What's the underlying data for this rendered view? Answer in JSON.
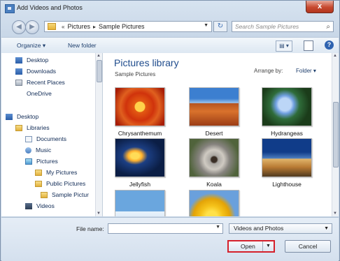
{
  "window": {
    "title": "Add Videos and Photos",
    "close_glyph": "x"
  },
  "nav": {
    "back": "◀",
    "forward": "▶"
  },
  "address": {
    "prefix": "«",
    "crumbs": [
      "Pictures",
      "Sample Pictures"
    ],
    "separator": "▸",
    "dropdown": "▼"
  },
  "refresh_icon": "refresh-icon",
  "search": {
    "placeholder": "Search Sample Pictures",
    "icon": "⌕"
  },
  "toolbar": {
    "organize": "Organize ▾",
    "new_folder": "New folder",
    "view": "▤ ▾",
    "help": "?"
  },
  "navpane": {
    "items": [
      {
        "label": "Desktop",
        "icon": "desktop-icon"
      },
      {
        "label": "Downloads",
        "icon": "downloads-icon"
      },
      {
        "label": "Recent Places",
        "icon": "recent-places-icon"
      },
      {
        "label": "OneDrive",
        "icon": "onedrive-icon"
      },
      {
        "label": "Desktop",
        "icon": "desktop-icon"
      },
      {
        "label": "Libraries",
        "icon": "libraries-icon"
      },
      {
        "label": "Documents",
        "icon": "documents-icon"
      },
      {
        "label": "Music",
        "icon": "music-icon"
      },
      {
        "label": "Pictures",
        "icon": "pictures-icon"
      },
      {
        "label": "My Pictures",
        "icon": "folder-icon"
      },
      {
        "label": "Public Pictures",
        "icon": "folder-icon"
      },
      {
        "label": "Sample Pictur",
        "icon": "folder-icon"
      },
      {
        "label": "Videos",
        "icon": "videos-icon"
      }
    ]
  },
  "content": {
    "title": "Pictures library",
    "subtitle": "Sample Pictures",
    "arrange_label": "Arrange by:",
    "arrange_value": "Folder ▾",
    "tiles": [
      {
        "label": "Chrysanthemum"
      },
      {
        "label": "Desert"
      },
      {
        "label": "Hydrangeas"
      },
      {
        "label": "Jellyfish"
      },
      {
        "label": "Koala"
      },
      {
        "label": "Lighthouse"
      },
      {
        "label": ""
      },
      {
        "label": ""
      }
    ]
  },
  "footer": {
    "file_name_label": "File name:",
    "file_name_value": "",
    "file_type": "Videos and Photos",
    "dropdown": "▼",
    "open": "Open",
    "open_arrow": "▼",
    "cancel": "Cancel"
  }
}
